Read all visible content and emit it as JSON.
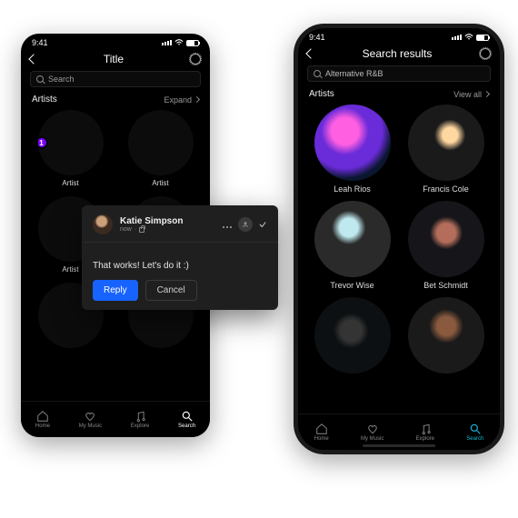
{
  "left": {
    "status_time": "9:41",
    "title": "Title",
    "search_placeholder": "Search",
    "section_title": "Artists",
    "section_action": "Expand",
    "artists": [
      {
        "label": "Artist",
        "badge": "1"
      },
      {
        "label": "Artist"
      },
      {
        "label": "Artist"
      },
      {
        "label": "Artist"
      },
      {
        "label": ""
      },
      {
        "label": ""
      }
    ]
  },
  "right": {
    "status_time": "9:41",
    "title": "Search results",
    "search_value": "Alternative R&B",
    "section_title": "Artists",
    "section_action": "View all",
    "artists": [
      {
        "label": "Leah Rios"
      },
      {
        "label": "Francis Cole"
      },
      {
        "label": "Trevor Wise"
      },
      {
        "label": "Bet Schmidt"
      },
      {
        "label": ""
      },
      {
        "label": ""
      }
    ]
  },
  "tabs": [
    {
      "label": "Home"
    },
    {
      "label": "My Music"
    },
    {
      "label": "Explore"
    },
    {
      "label": "Search"
    }
  ],
  "comment": {
    "author": "Katie Simpson",
    "time": "now",
    "body": "That works! Let's do it :)",
    "reply_label": "Reply",
    "cancel_label": "Cancel"
  }
}
